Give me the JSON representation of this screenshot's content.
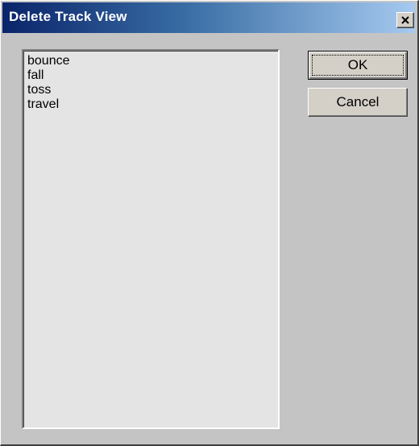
{
  "window": {
    "title": "Delete Track View",
    "close_icon": "close-icon"
  },
  "list": {
    "items": [
      "bounce",
      "fall",
      "toss",
      "travel"
    ]
  },
  "buttons": {
    "ok_label": "OK",
    "cancel_label": "Cancel"
  },
  "colors": {
    "title_gradient_start": "#0a246a",
    "title_gradient_end": "#a6caf0",
    "dialog_background": "#c4c4c4",
    "list_background": "#e4e4e4"
  }
}
